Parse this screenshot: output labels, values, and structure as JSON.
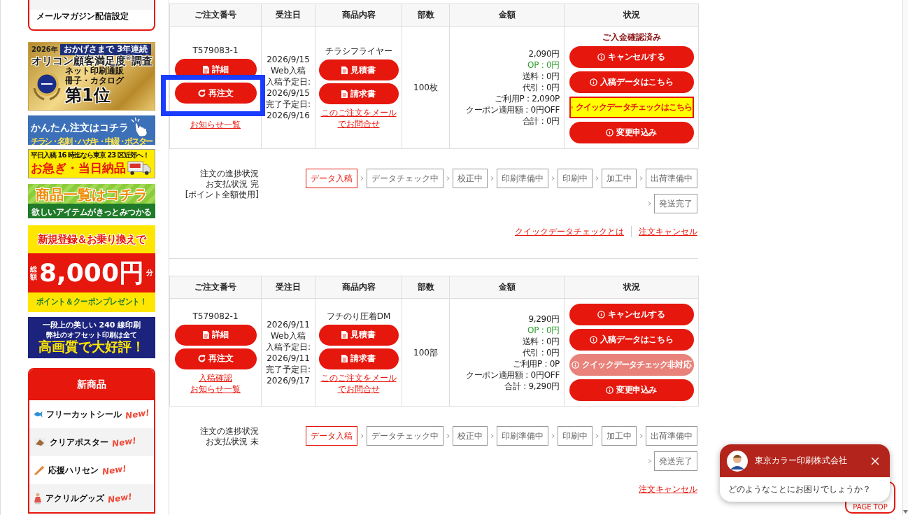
{
  "sidebar": {
    "account_menu": {
      "item": "メールマガジン配信設定"
    },
    "banners": [
      {
        "kind": "ranking",
        "year": "2026年",
        "tagline": "おかげさまで 3年連続",
        "survey": "オリコン顧客満足度$^{®}$調査",
        "category": [
          "ネット印刷通販",
          "冊子・カタログ"
        ],
        "rank": "第1位"
      },
      {
        "kind": "easy_order",
        "title": "かんたん注文はコチラ",
        "subtitle": "チラシ・名刺・ハガキ・中綴・ポスター"
      },
      {
        "kind": "same_day",
        "title": "平日入稿 16 時迄なら東京 23 区近郊へ！",
        "headline": "お急ぎ・当日納品"
      },
      {
        "kind": "catalog",
        "title": "商品一覧はコチラ",
        "subtitle": "欲しいアイテムがきっとみつかる"
      },
      {
        "kind": "campaign",
        "title": "新規登録＆お乗り換えで",
        "prefix": "総額",
        "amount": "8,000円",
        "suffix": "分",
        "footer": "ポイント＆クーポンプレゼント！"
      },
      {
        "kind": "quality",
        "title": "一段上の美しい 240 線印刷",
        "subtitle": "弊社のオフセット印刷は全て",
        "headline": "高画質で大好評！"
      }
    ],
    "new_products": {
      "title": "新商品",
      "items": [
        {
          "name": "フリーカットシール",
          "badge": "New!"
        },
        {
          "name": "クリアポスター",
          "badge": "New!"
        },
        {
          "name": "応援ハリセン",
          "badge": "New!"
        },
        {
          "name": "アクリルグッズ",
          "badge": "New!"
        }
      ]
    }
  },
  "orders": [
    {
      "columns": [
        "ご注文番号",
        "受注日",
        "商品内容",
        "部数",
        "金額",
        "状況"
      ],
      "order_number": "T579083-1",
      "order_buttons": [
        {
          "kind": "detail",
          "label": "詳細",
          "highlighted": false
        },
        {
          "kind": "reorder",
          "label": "再注文",
          "highlighted": true
        }
      ],
      "links": [
        "お知らせ一覧"
      ],
      "dates": [
        "2026/9/15",
        "Web入稿",
        "入稿予定日:",
        "2026/9/15",
        "完了予定日:",
        "2026/9/16"
      ],
      "product": {
        "name": "チラシフライヤー",
        "buttons": [
          "見積書",
          "請求書"
        ],
        "inquiry_link": "このご注文をメールでお問合せ"
      },
      "quantity": "100枚",
      "amounts": [
        {
          "kind": "plain",
          "text": "2,090円"
        },
        {
          "kind": "points",
          "text": "OP : 0円"
        },
        {
          "kind": "plain",
          "text": "送料 : 0円"
        },
        {
          "kind": "plain",
          "text": "代引 : 0円"
        },
        {
          "kind": "plain",
          "text": "ご利用P : 2,090P"
        },
        {
          "kind": "plain",
          "text": "クーポン適用額 : 0円OFF"
        },
        {
          "kind": "plain",
          "text": "合計 : 0円"
        }
      ],
      "status": {
        "label": "ご入金確認済み",
        "buttons": [
          {
            "kind": "normal",
            "label": "キャンセルする",
            "disabled": false
          },
          {
            "kind": "normal",
            "label": "入稿データはこちら",
            "disabled": false
          },
          {
            "kind": "quick",
            "label": "クイックデータチェックはこちら",
            "disabled": false
          },
          {
            "kind": "normal",
            "label": "変更申込み",
            "disabled": false
          }
        ]
      },
      "progress": {
        "labels": [
          "注文の進捗状況",
          "お支払状況 完",
          "[ポイント全額使用]"
        ],
        "steps": [
          {
            "label": "データ入稿",
            "selected": true
          },
          {
            "label": "データチェック中",
            "selected": false
          },
          {
            "label": "校正中",
            "selected": false
          },
          {
            "label": "印刷準備中",
            "selected": false
          },
          {
            "label": "印刷中",
            "selected": false
          },
          {
            "label": "加工中",
            "selected": false
          },
          {
            "label": "出荷準備中",
            "selected": false
          },
          {
            "label": "発送完了",
            "selected": false
          }
        ]
      },
      "footer_links": [
        "クイックデータチェックとは",
        "注文キャンセル"
      ]
    },
    {
      "columns": [
        "ご注文番号",
        "受注日",
        "商品内容",
        "部数",
        "金額",
        "状況"
      ],
      "order_number": "T579082-1",
      "order_buttons": [
        {
          "kind": "detail",
          "label": "詳細",
          "highlighted": false
        },
        {
          "kind": "reorder",
          "label": "再注文",
          "highlighted": false
        }
      ],
      "links": [
        "入稿確認",
        "お知らせ一覧"
      ],
      "dates": [
        "2026/9/11",
        "Web入稿",
        "入稿予定日:",
        "2026/9/11",
        "完了予定日:",
        "2026/9/17"
      ],
      "product": {
        "name": "フチのり圧着DM",
        "buttons": [
          "見積書",
          "請求書"
        ],
        "inquiry_link": "このご注文をメールでお問合せ"
      },
      "quantity": "100部",
      "amounts": [
        {
          "kind": "plain",
          "text": "9,290円"
        },
        {
          "kind": "points",
          "text": "OP : 0円"
        },
        {
          "kind": "plain",
          "text": "送料 : 0円"
        },
        {
          "kind": "plain",
          "text": "代引 : 0円"
        },
        {
          "kind": "plain",
          "text": "ご利用P : 0P"
        },
        {
          "kind": "plain",
          "text": "クーポン適用額 : 0円OFF"
        },
        {
          "kind": "plain",
          "text": "合計 : 9,290円"
        }
      ],
      "status": {
        "buttons": [
          {
            "kind": "normal",
            "label": "キャンセルする",
            "disabled": false
          },
          {
            "kind": "normal",
            "label": "入稿データはこちら",
            "disabled": false
          },
          {
            "kind": "quick",
            "label": "クイックデータチェック非対応",
            "disabled": true
          },
          {
            "kind": "normal",
            "label": "変更申込み",
            "disabled": false
          }
        ]
      },
      "progress": {
        "labels": [
          "注文の進捗状況",
          "お支払状況 未"
        ],
        "steps": [
          {
            "label": "データ入稿",
            "selected": true
          },
          {
            "label": "データチェック中",
            "selected": false
          },
          {
            "label": "校正中",
            "selected": false
          },
          {
            "label": "印刷準備中",
            "selected": false
          },
          {
            "label": "印刷中",
            "selected": false
          },
          {
            "label": "加工中",
            "selected": false
          },
          {
            "label": "出荷準備中",
            "selected": false
          },
          {
            "label": "発送完了",
            "selected": false
          }
        ]
      },
      "footer_links": [
        "注文キャンセル"
      ]
    }
  ],
  "page_top": {
    "label": "PAGE TOP"
  },
  "chat": {
    "company": "東京カラー印刷株式会社",
    "message": "どのようなことにお困りでしょうか？"
  }
}
